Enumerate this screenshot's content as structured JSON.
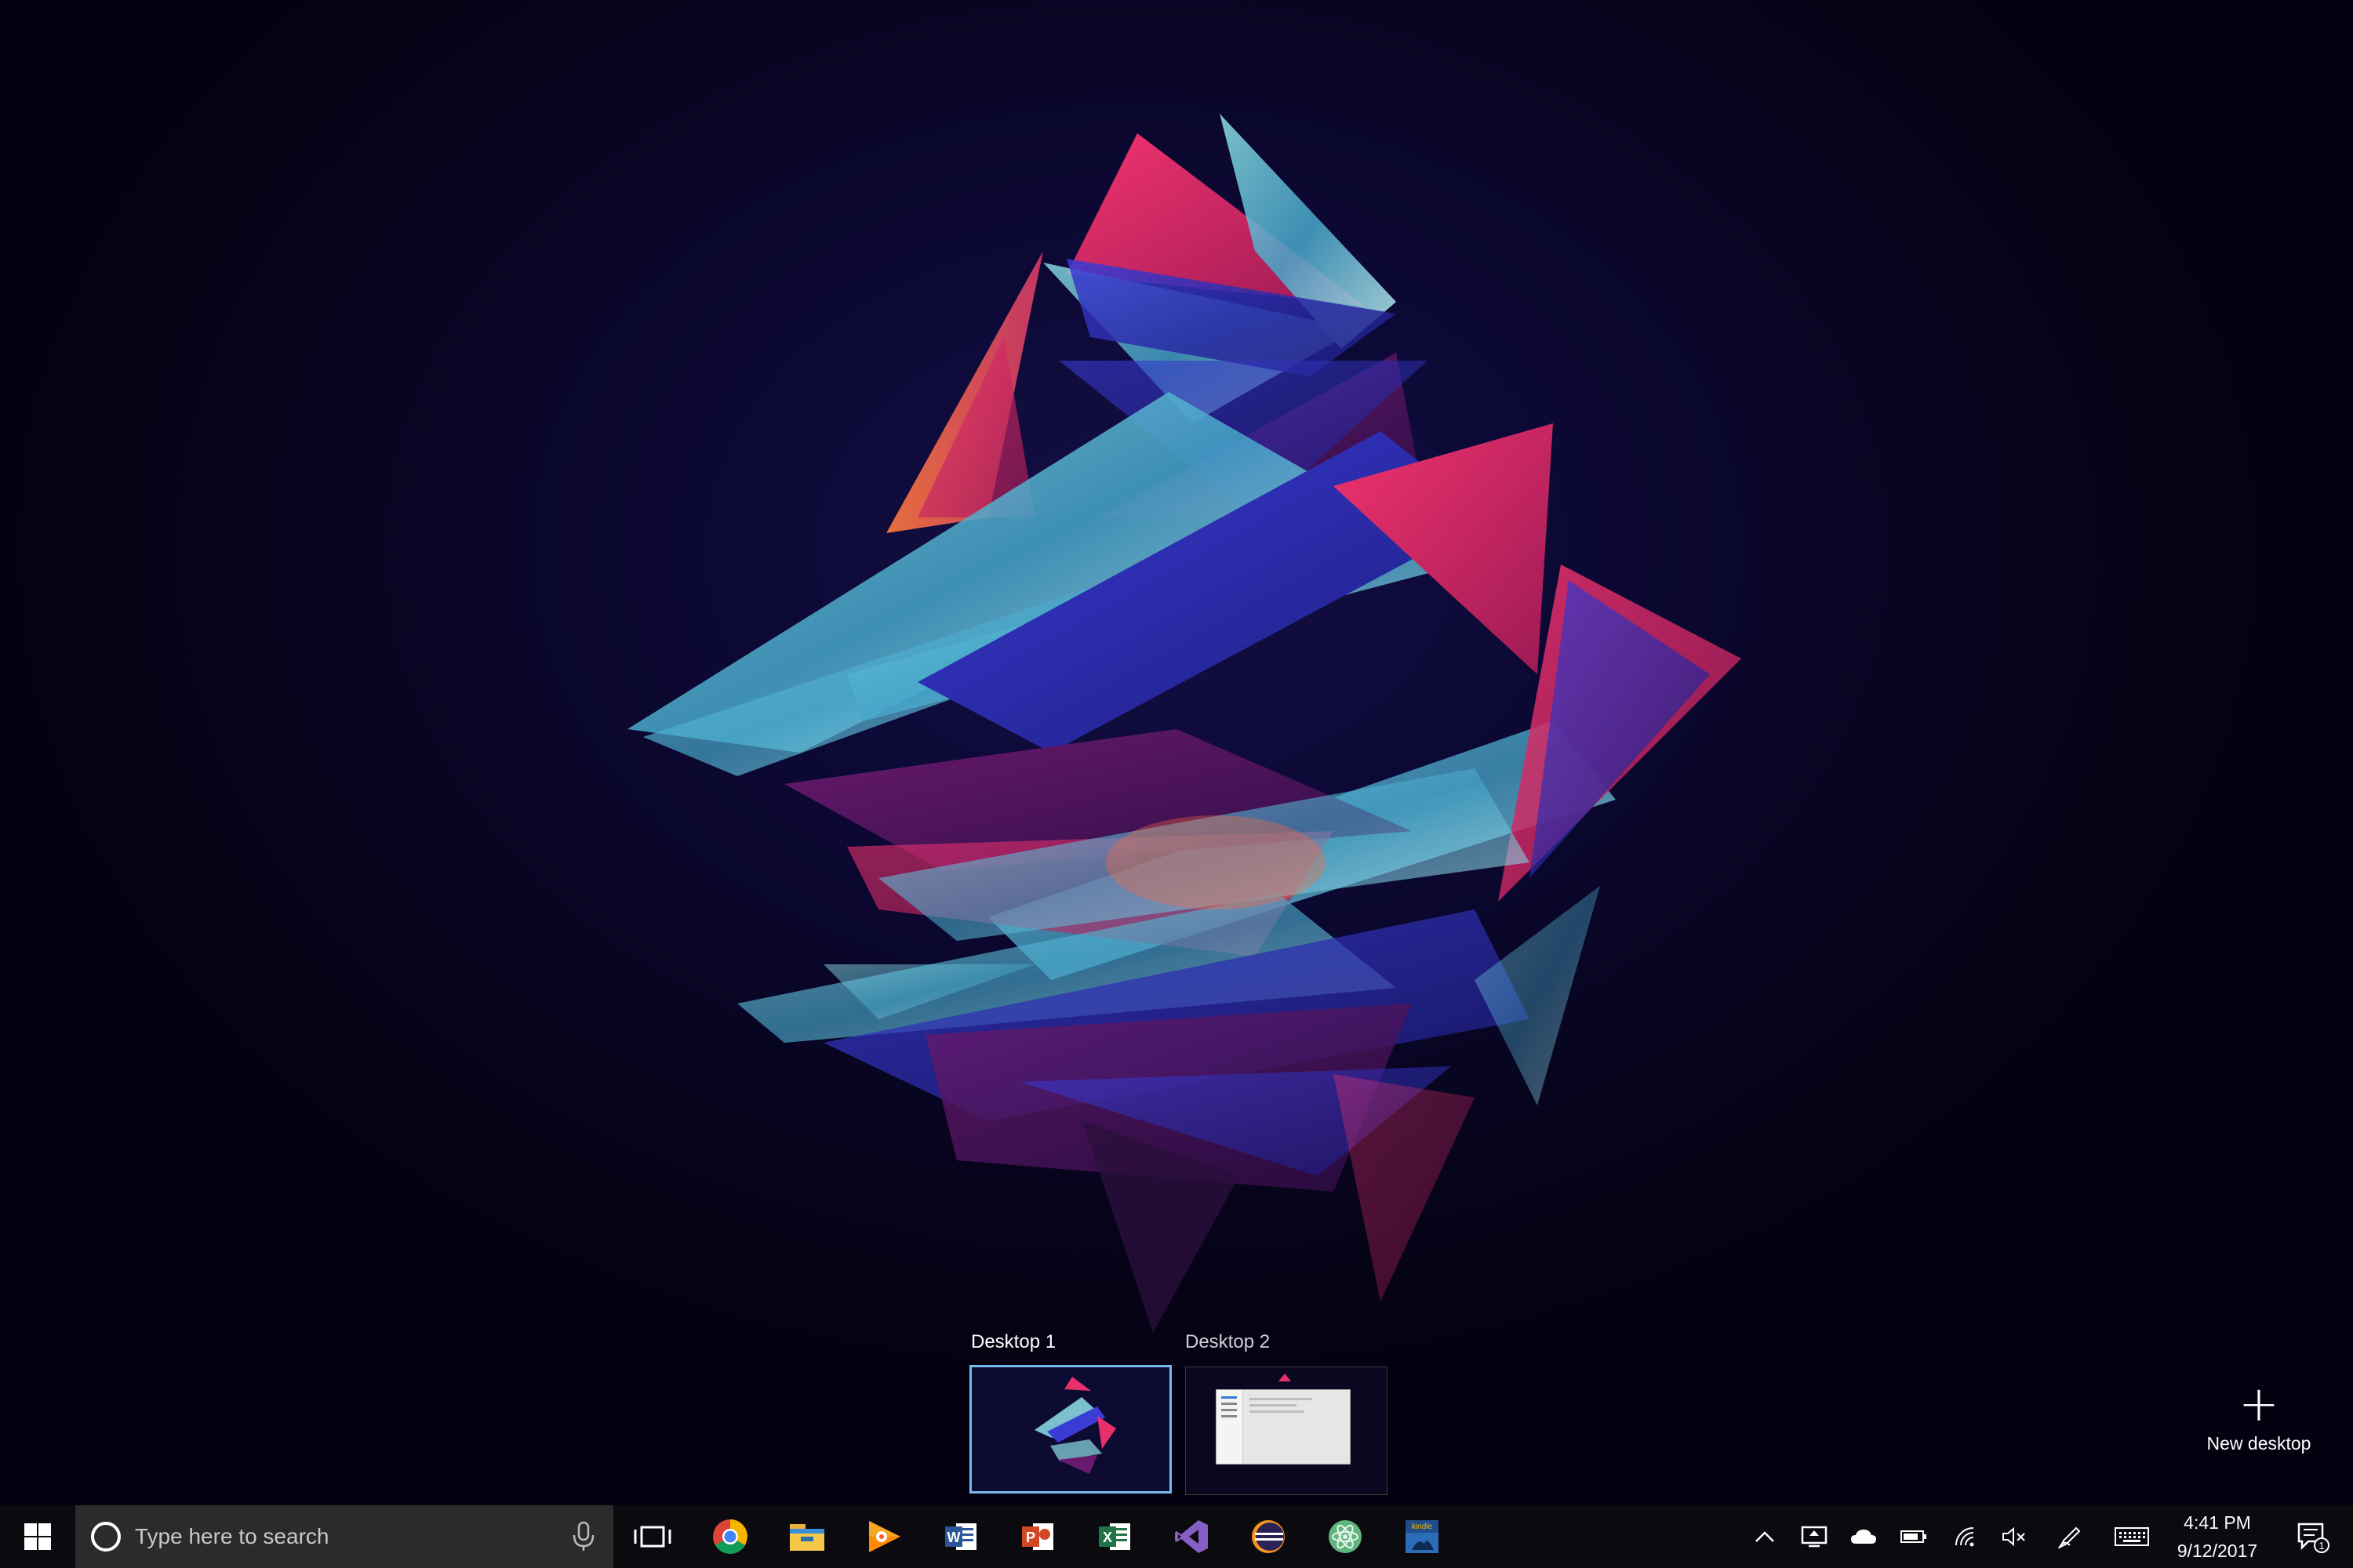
{
  "task_view": {
    "desktops": [
      {
        "label": "Desktop 1",
        "active": true
      },
      {
        "label": "Desktop 2",
        "active": false
      }
    ],
    "new_desktop_label": "New desktop"
  },
  "taskbar": {
    "search_placeholder": "Type here to search",
    "pinned_apps": [
      "chrome-icon",
      "file-explorer-icon",
      "google-play-music-icon",
      "word-icon",
      "powerpoint-icon",
      "excel-icon",
      "visual-studio-icon",
      "eclipse-icon",
      "atom-icon",
      "kindle-icon"
    ],
    "kindle_label": "kindle",
    "clock_time": "4:41 PM",
    "clock_date": "9/12/2017",
    "notification_count": "1"
  },
  "colors": {
    "taskbar": "#0a0a0f",
    "search_box": "#2b2b2b",
    "active_desktop_border": "#76b9ed"
  }
}
